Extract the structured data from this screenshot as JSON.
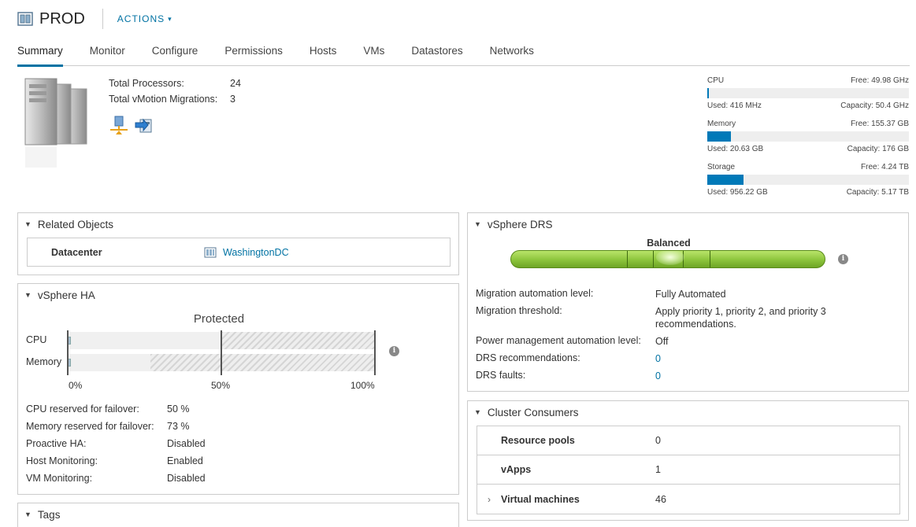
{
  "header": {
    "title": "PROD",
    "actions_label": "ACTIONS"
  },
  "tabs": [
    "Summary",
    "Monitor",
    "Configure",
    "Permissions",
    "Hosts",
    "VMs",
    "Datastores",
    "Networks"
  ],
  "summary": {
    "processors_label": "Total Processors:",
    "processors_value": "24",
    "vmotion_label": "Total vMotion Migrations:",
    "vmotion_value": "3"
  },
  "resources": {
    "cpu": {
      "name": "CPU",
      "free": "Free: 49.98 GHz",
      "used": "Used: 416 MHz",
      "capacity": "Capacity: 50.4 GHz",
      "fraction": 0.008
    },
    "memory": {
      "name": "Memory",
      "free": "Free: 155.37 GB",
      "used": "Used: 20.63 GB",
      "capacity": "Capacity: 176 GB",
      "fraction": 0.117
    },
    "storage": {
      "name": "Storage",
      "free": "Free: 4.24 TB",
      "used": "Used: 956.22 GB",
      "capacity": "Capacity: 5.17 TB",
      "fraction": 0.18
    }
  },
  "related": {
    "title": "Related Objects",
    "datacenter_label": "Datacenter",
    "datacenter_value": "WashingtonDC"
  },
  "ha": {
    "title": "vSphere HA",
    "chart_title": "Protected",
    "cpu_label": "CPU",
    "memory_label": "Memory",
    "axis": [
      "0%",
      "50%",
      "100%"
    ],
    "cpu_reserved_fraction": 0.5,
    "memory_reserved_fraction": 0.73,
    "rows": [
      {
        "k": "CPU reserved for failover:",
        "v": "50 %"
      },
      {
        "k": "Memory reserved for failover:",
        "v": "73 %"
      },
      {
        "k": "Proactive HA:",
        "v": "Disabled"
      },
      {
        "k": "Host Monitoring:",
        "v": "Enabled"
      },
      {
        "k": "VM Monitoring:",
        "v": "Disabled"
      }
    ]
  },
  "tags": {
    "title": "Tags"
  },
  "drs": {
    "title": "vSphere DRS",
    "status": "Balanced",
    "rows": [
      {
        "k": "Migration automation level:",
        "v": "Fully Automated"
      },
      {
        "k": "Migration threshold:",
        "v": "Apply priority 1, priority 2, and priority 3 recommendations."
      },
      {
        "k": "Power management automation level:",
        "v": "Off"
      },
      {
        "k": "DRS recommendations:",
        "v": "0"
      },
      {
        "k": "DRS faults:",
        "v": "0"
      }
    ]
  },
  "consumers": {
    "title": "Cluster Consumers",
    "rows": [
      {
        "k": "Resource pools",
        "v": "0"
      },
      {
        "k": "vApps",
        "v": "1"
      },
      {
        "k": "Virtual machines",
        "v": "46"
      }
    ]
  },
  "colors": {
    "accent": "#0072a3",
    "bar": "#0079b8",
    "drs_green": "#8cc43c"
  },
  "icons": [
    "cluster-icon",
    "server-icon",
    "host-network-icon",
    "vmotion-icon",
    "datacenter-icon",
    "info-icon",
    "caret-down-icon",
    "chevron-right-icon"
  ]
}
